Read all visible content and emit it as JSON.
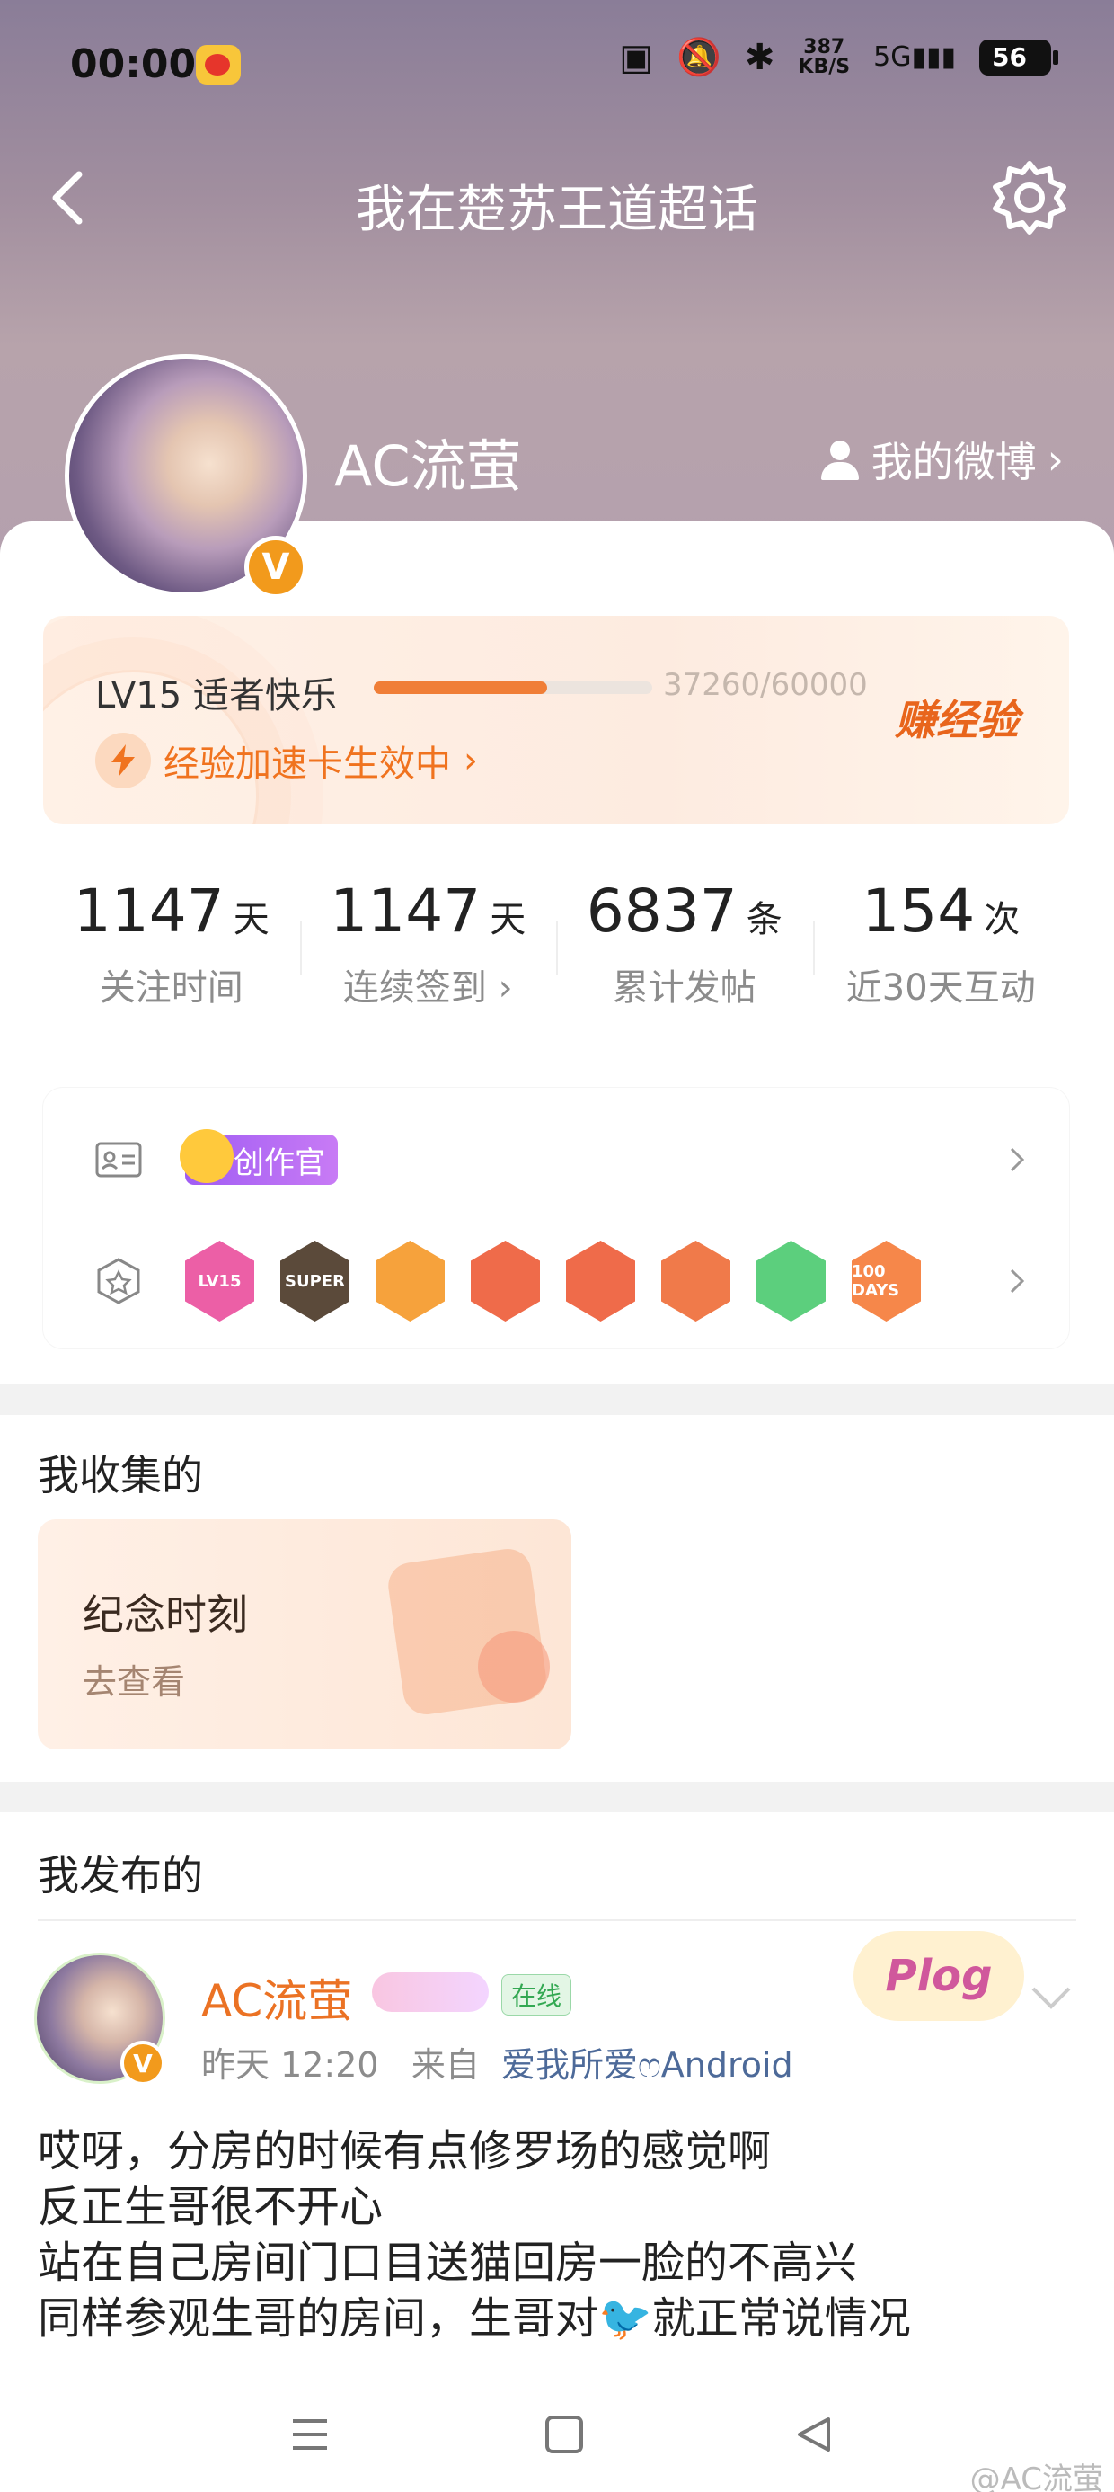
{
  "status_bar": {
    "time": "00:00",
    "net_speed": "387",
    "net_unit": "KB/S",
    "network": "5G",
    "battery": "56"
  },
  "header": {
    "title": "我在楚苏王道超话"
  },
  "profile": {
    "name": "AC流萤",
    "verified": "V",
    "my_weibo": "我的微博"
  },
  "level": {
    "title": "LV15 适者快乐",
    "progress_text": "37260/60000",
    "current": 37260,
    "max": 60000,
    "earn": "赚经验",
    "boost": "经验加速卡生效中"
  },
  "stats": [
    {
      "value": "1147",
      "unit": "天",
      "label": "关注时间"
    },
    {
      "value": "1147",
      "unit": "天",
      "label": "连续签到"
    },
    {
      "value": "6837",
      "unit": "条",
      "label": "累计发帖"
    },
    {
      "value": "154",
      "unit": "次",
      "label": "近30天互动"
    }
  ],
  "badges": {
    "creator_label": "创作官",
    "medals": [
      "LV15",
      "SUPER",
      "",
      "",
      "",
      "",
      "",
      "100 DAYS"
    ]
  },
  "collected": {
    "section_title": "我收集的",
    "card_title": "纪念时刻",
    "card_sub": "去查看"
  },
  "published": {
    "section_title": "我发布的"
  },
  "post": {
    "author": "AC流萤",
    "verified": "V",
    "online": "在线",
    "plog": "Plog",
    "time": "昨天 12:20",
    "from_label": "来自",
    "source": "爱我所爱ෆAndroid",
    "lines": [
      "哎呀，分房的时候有点修罗场的感觉啊",
      "反正生哥很不开心",
      "站在自己房间门口目送猫回房一脸的不高兴",
      "同样参观生哥的房间，生哥对🐦就正常说情况"
    ]
  },
  "watermark": "@AC流萤",
  "colors": {
    "accent": "#f07e37",
    "name_orange": "#eb7224",
    "verified_orange": "#f29a1c"
  }
}
